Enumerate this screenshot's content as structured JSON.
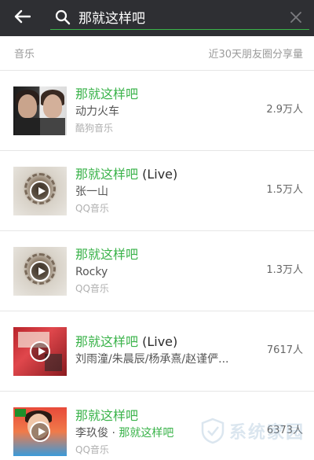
{
  "header": {
    "back_icon": "back-arrow-icon",
    "search_icon": "search-icon",
    "search_value": "那就这样吧",
    "clear_icon": "close-icon",
    "bg_color": "#2e2f33",
    "accent_color": "#3ab34a"
  },
  "section": {
    "label": "音乐",
    "sort_label": "近30天朋友圈分享量"
  },
  "results": [
    {
      "title": "那就这样吧",
      "title_suffix": "",
      "artist": "动力火车",
      "artist_highlight": "",
      "source": "酷狗音乐",
      "shares": "2.9万人",
      "has_play": false
    },
    {
      "title": "那就这样吧",
      "title_suffix": " (Live)",
      "artist": "张一山",
      "artist_highlight": "",
      "source": "QQ音乐",
      "shares": "1.5万人",
      "has_play": true
    },
    {
      "title": "那就这样吧",
      "title_suffix": "",
      "artist": "Rocky",
      "artist_highlight": "",
      "source": "QQ音乐",
      "shares": "1.3万人",
      "has_play": true
    },
    {
      "title": "那就这样吧",
      "title_suffix": " (Live)",
      "artist": "刘雨潼/朱晨辰/杨承熹/赵谨俨...",
      "artist_highlight": "",
      "source": "",
      "shares": "7617人",
      "has_play": true
    },
    {
      "title": "那就这样吧",
      "title_suffix": "",
      "artist": "李玖俊 · ",
      "artist_highlight": "那就这样吧",
      "source": "QQ音乐",
      "shares": "6373人",
      "has_play": true
    }
  ],
  "watermark": {
    "text": "系统家园"
  }
}
